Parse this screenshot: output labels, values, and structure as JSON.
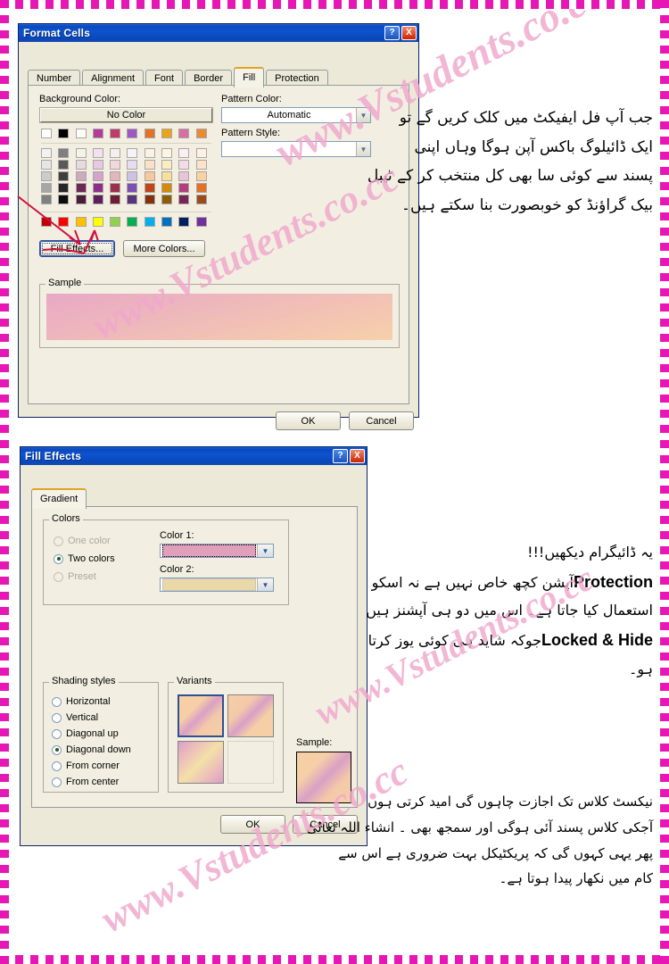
{
  "page": {
    "watermark_text": "www.Vstudents.co.cc",
    "border_color": "#e617b5",
    "background": "#ffffff"
  },
  "format_cells_dialog": {
    "title": "Format Cells",
    "help_button": "?",
    "close_button": "X",
    "tabs": [
      {
        "label": "Number",
        "active": false
      },
      {
        "label": "Alignment",
        "active": false
      },
      {
        "label": "Font",
        "active": false
      },
      {
        "label": "Border",
        "active": false
      },
      {
        "label": "Fill",
        "active": true
      },
      {
        "label": "Protection",
        "active": false
      }
    ],
    "background_color_label": "Background Color:",
    "no_color_button": "No Color",
    "pattern_color_label": "Pattern Color:",
    "pattern_color_value": "Automatic",
    "pattern_style_label": "Pattern Style:",
    "pattern_style_value": "",
    "fill_effects_button": "Fill Effects...",
    "more_colors_button": "More Colors...",
    "sample_label": "Sample",
    "sample_gradient_from": "#e8a8c6",
    "sample_gradient_to": "#f7d0aa",
    "ok_button": "OK",
    "cancel_button": "Cancel",
    "palette": {
      "theme_row": [
        "#ffffff",
        "#000000",
        "#fdfdf6",
        "#b53b9a",
        "#c03a6b",
        "#9f59c7",
        "#e2722a",
        "#eaa31b",
        "#d86fa4",
        "#e98b35"
      ],
      "tint_rows": [
        [
          "#f2f2f2",
          "#7f7f7f",
          "#f4f3ea",
          "#f3e1ef",
          "#f7efef",
          "#f5f2fa",
          "#fdf0e6",
          "#fdf5e2",
          "#faeff4",
          "#fdf1e6"
        ],
        [
          "#e6e6e6",
          "#595959",
          "#e8d8df",
          "#e6c9e3",
          "#f0d8dd",
          "#e6def0",
          "#fbe0c8",
          "#fbecc2",
          "#f3dce8",
          "#fbe2c8"
        ],
        [
          "#cccccc",
          "#3f3f3f",
          "#cfa9bf",
          "#d4a3d0",
          "#e3b6bf",
          "#cfc0e6",
          "#f8c79d",
          "#f8e099",
          "#e8c4da",
          "#f8d2a5"
        ],
        [
          "#a6a6a6",
          "#262626",
          "#6b2a56",
          "#8c2f8a",
          "#9c2f4d",
          "#7b4fb5",
          "#c0451a",
          "#d08a0d",
          "#b2407f",
          "#e2722a"
        ],
        [
          "#808080",
          "#0d0d0d",
          "#4a1d3a",
          "#5e1f5c",
          "#6b1f35",
          "#55357c",
          "#84300f",
          "#8c5c08",
          "#77265a",
          "#9b4c1a"
        ]
      ],
      "standard_row": [
        "#c00000",
        "#ff0000",
        "#ffc000",
        "#ffff00",
        "#92d050",
        "#00b050",
        "#00b0f0",
        "#0070c0",
        "#002060",
        "#7030a0"
      ]
    }
  },
  "fill_effects_dialog": {
    "title": "Fill Effects",
    "help_button": "?",
    "close_button": "X",
    "tabs": [
      {
        "label": "Gradient",
        "active": true
      }
    ],
    "colors_group_label": "Colors",
    "radios": [
      {
        "label": "One color",
        "checked": false,
        "disabled": true
      },
      {
        "label": "Two colors",
        "checked": true,
        "disabled": false
      },
      {
        "label": "Preset",
        "checked": false,
        "disabled": true
      }
    ],
    "color1_label": "Color 1:",
    "color1_value": "#e0a0bc",
    "color2_label": "Color 2:",
    "color2_value": "#ebd8a8",
    "shading_styles_label": "Shading styles",
    "shading_styles": [
      {
        "label": "Horizontal",
        "checked": false
      },
      {
        "label": "Vertical",
        "checked": false
      },
      {
        "label": "Diagonal up",
        "checked": false
      },
      {
        "label": "Diagonal down",
        "checked": true
      },
      {
        "label": "From corner",
        "checked": false
      },
      {
        "label": "From center",
        "checked": false
      }
    ],
    "variants_label": "Variants",
    "variants": [
      {
        "selected": true
      },
      {
        "selected": false
      },
      {
        "selected": false
      },
      {
        "selected": false
      }
    ],
    "sample_label": "Sample:",
    "ok_button": "OK",
    "cancel_button": "Cancel"
  },
  "urdu_top": {
    "lines": [
      "جب آپ فل ایفیکٹ میں کلک کریں گے تو",
      "ایک ڈائیلوگ باکس آپن ہوگا وہاں اپنی",
      "پسند سے کوئی سا بھی کل منتخب کر کے ٹیبل",
      "بیک گراؤنڈ کو خوبصورت بنا سکتے ہیں۔"
    ]
  },
  "urdu_middle": {
    "line1": "یہ ڈائیگرام دیکھیں!!!",
    "line2_pre": "آپشن کچھ خاص نہیں ہے نہ اسکو",
    "line2_eng": "Protection",
    "line3": "استعمال کیا جاتا ہے۔ اس میں دو ہی آپشنز ہیں",
    "line4_pre": "جوکہ شاید ہی کوئی یوز کرتا",
    "line4_eng": "Locked & Hide",
    "line5": "ہو۔"
  },
  "urdu_bottom": {
    "lines": [
      "نیکسٹ کلاس تک اجازت چاہوں گی امید کرتی ہوں",
      "آجکی کلاس پسند آئی ہوگی اور سمجھ بھی ۔ انشاء اللہ تعالیٰ",
      "پھر یہی کہوں گی کہ پریکٹیکل بہت ضروری ہے اس سے",
      "کام میں نکھار پیدا ہوتا ہے۔"
    ]
  }
}
